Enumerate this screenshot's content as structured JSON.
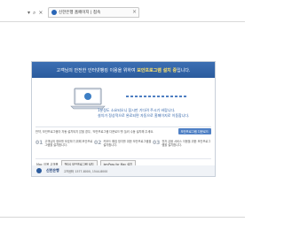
{
  "browser": {
    "tab_title": "신한은행 홈페이지 | 접속"
  },
  "banner": {
    "prefix": "고객님의 안전한 인터넷뱅킹 이용을 위하여",
    "highlight": "보안프로그램 설치 중",
    "suffix": "입니다."
  },
  "install": {
    "message1": "1분정도 소요되오니 잠시만 기다려 주시기 바랍니다.",
    "message2": "설치가 정상적으로 완료되면 자동으로 홈페이지로 이동합니다."
  },
  "info": {
    "text": "만약, 보안프로그램이 자동 설치되지 않을 경우, '보안프로그램 다운로드'를 눌러 수동 설치해 주세요.",
    "button_label": "보안프로그램 다운로드"
  },
  "steps": [
    {
      "num": "01",
      "text": "고객님의 정보를 보호하기 위해 보안프로그램을 설치합니다."
    },
    {
      "num": "02",
      "text": "키보드 해킹 방지를 위한 보안프로그램을 설치합니다."
    },
    {
      "num": "03",
      "text": "전자 금융 서비스 이용을 위한 보안프로그램을 설치합니다."
    }
  ],
  "mac": {
    "label": "Mac 이용 고객용",
    "button1": "맥OS 보안프로그램 설치",
    "button2": "keyPass for Mac 설치"
  },
  "footer": {
    "logo": "신한은행",
    "info": "고객센터 1577-8000, 1544-8000"
  }
}
